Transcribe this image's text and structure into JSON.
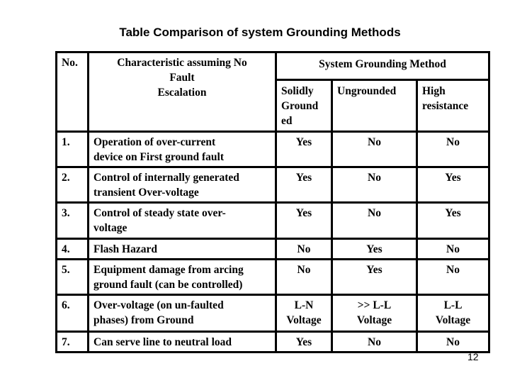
{
  "title": "Table Comparison of system Grounding Methods",
  "table": {
    "header": {
      "no": "No.",
      "characteristic_line1": "Characteristic assuming No",
      "characteristic_line2": "Fault",
      "characteristic_line3": "Escalation",
      "group": "System Grounding Method",
      "methods": [
        {
          "line1": "Solidly",
          "line2": "Ground",
          "line3": "ed"
        },
        {
          "line1": "Ungrounded"
        },
        {
          "line1": "High",
          "line2": "resistance"
        }
      ]
    },
    "rows": [
      {
        "no": "1.",
        "characteristic": [
          "Operation of over-current",
          "device on First ground fault"
        ],
        "solidly": [
          "Yes"
        ],
        "ungrounded": [
          "No"
        ],
        "high_resistance": [
          "No"
        ]
      },
      {
        "no": "2.",
        "characteristic": [
          "Control of internally generated",
          "transient Over-voltage"
        ],
        "solidly": [
          "Yes"
        ],
        "ungrounded": [
          "No"
        ],
        "high_resistance": [
          "Yes"
        ]
      },
      {
        "no": "3.",
        "characteristic": [
          "Control of steady state over-",
          "voltage"
        ],
        "solidly": [
          "Yes"
        ],
        "ungrounded": [
          "No"
        ],
        "high_resistance": [
          "Yes"
        ]
      },
      {
        "no": "4.",
        "characteristic": [
          "Flash Hazard"
        ],
        "solidly": [
          "No"
        ],
        "ungrounded": [
          "Yes"
        ],
        "high_resistance": [
          "No"
        ]
      },
      {
        "no": "5.",
        "characteristic": [
          "Equipment damage from arcing",
          "ground fault (can be controlled)"
        ],
        "solidly": [
          "No"
        ],
        "ungrounded": [
          "Yes"
        ],
        "high_resistance": [
          "No"
        ]
      },
      {
        "no": "6.",
        "characteristic": [
          "Over-voltage (on un-faulted",
          "phases) from Ground"
        ],
        "solidly": [
          "L-N",
          "Voltage"
        ],
        "ungrounded": [
          ">> L-L",
          "Voltage"
        ],
        "high_resistance": [
          "L-L",
          "Voltage"
        ]
      },
      {
        "no": "7.",
        "characteristic": [
          "Can serve line to neutral load"
        ],
        "solidly": [
          "Yes"
        ],
        "ungrounded": [
          "No"
        ],
        "high_resistance": [
          "No"
        ]
      }
    ]
  },
  "page_number": "12"
}
